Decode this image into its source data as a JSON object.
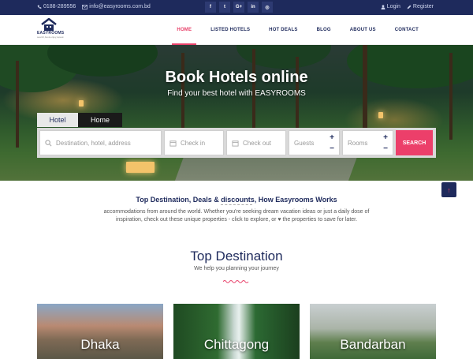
{
  "topbar": {
    "phone": "0188-289556",
    "email": "info@easyrooms.com.bd",
    "social": [
      "f",
      "t",
      "G+",
      "in",
      "◎"
    ],
    "login": "Login",
    "register": "Register"
  },
  "logo": {
    "brand": "EASYROOMS",
    "tagline": "search,book,enjoy,repeat"
  },
  "nav": {
    "items": [
      "HOME",
      "LISTED HOTELS",
      "HOT DEALS",
      "BLOG",
      "ABOUT US",
      "CONTACT"
    ],
    "active": "HOME"
  },
  "hero": {
    "title": "Book Hotels online",
    "subtitle": "Find your best hotel with EASYROOMS",
    "tabs": [
      "Hotel",
      "Home"
    ],
    "search": {
      "destination_placeholder": "Destination, hotel, address",
      "checkin_placeholder": "Check in",
      "checkout_placeholder": "Check out",
      "guests_label": "Guests",
      "rooms_label": "Rooms",
      "plus": "+",
      "minus": "−",
      "button": "SEARCH"
    }
  },
  "intro": {
    "title": "Top Destination, Deals & discounts, How Easyrooms Works",
    "text": "accommodations from around the world. Whether you're seeking dream vacation ideas or just a daily dose of inspiration, check out these unique properties - click to explore, or ♥ the properties to save for later."
  },
  "scroll_top_icon": "↑",
  "top_destination": {
    "title": "Top Destination",
    "subtitle": "We help you planning your journey",
    "cards": [
      "Dhaka",
      "Chittagong",
      "Bandarban"
    ]
  },
  "colors": {
    "navy": "#1e2a5c",
    "accent": "#e8416a"
  }
}
